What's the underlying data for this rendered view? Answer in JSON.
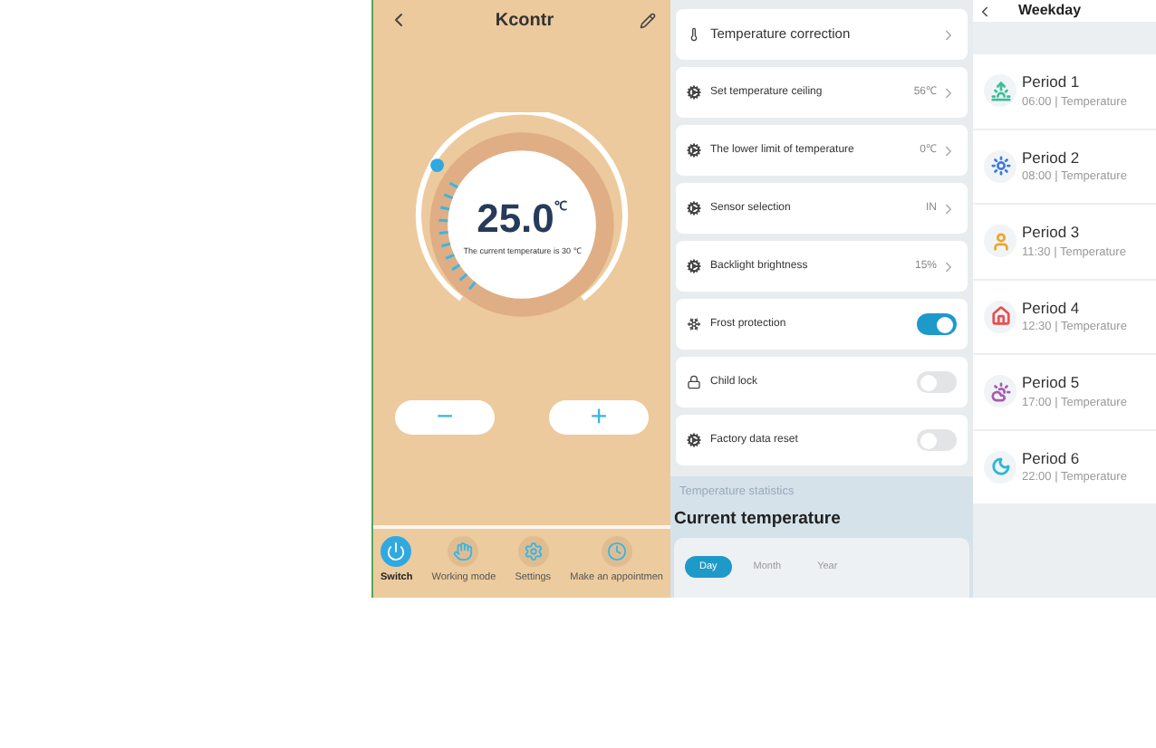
{
  "thermostat": {
    "title": "Kcontr",
    "set_temperature": "25.0",
    "unit": "℃",
    "current_text": "The current temperature is 30 ℃",
    "minus": "−",
    "plus": "+"
  },
  "nav": [
    {
      "label": "Switch",
      "kind": "power",
      "selected": true
    },
    {
      "label": "Working mode",
      "kind": "hand",
      "selected": false
    },
    {
      "label": "Settings",
      "kind": "gear",
      "selected": false
    },
    {
      "label": "Make an appointmen",
      "kind": "clock",
      "selected": false
    }
  ],
  "settings": [
    {
      "label": "Temperature correction",
      "kind": "link"
    },
    {
      "label": "Set temperature ceiling",
      "kind": "link",
      "value": "56℃"
    },
    {
      "label": "The lower limit of temperature",
      "kind": "link",
      "value": "0℃"
    },
    {
      "label": "Sensor selection",
      "kind": "link",
      "value": "IN"
    },
    {
      "label": "Backlight brightness",
      "kind": "link",
      "value": "15%"
    },
    {
      "label": "Frost protection",
      "kind": "toggle",
      "on": true
    },
    {
      "label": "Child lock",
      "kind": "toggle",
      "on": false
    },
    {
      "label": "Factory data reset",
      "kind": "toggle",
      "on": false
    }
  ],
  "statistics": {
    "section": "Temperature statistics",
    "title": "Current temperature",
    "tabs": [
      {
        "label": "Day",
        "selected": true
      },
      {
        "label": "Month",
        "selected": false
      },
      {
        "label": "Year",
        "selected": false
      }
    ]
  },
  "schedule": {
    "title": "Weekday",
    "periods": [
      {
        "name": "Period 1",
        "detail": "06:00 | Temperature",
        "kind": "sunrise",
        "color": "#3cbf9a"
      },
      {
        "name": "Period 2",
        "detail": "08:00 | Temperature",
        "kind": "sun",
        "color": "#3b7de0"
      },
      {
        "name": "Period 3",
        "detail": "11:30 | Temperature",
        "kind": "person",
        "color": "#f0a52a"
      },
      {
        "name": "Period 4",
        "detail": "12:30 | Temperature",
        "kind": "home",
        "color": "#e8504f"
      },
      {
        "name": "Period 5",
        "detail": "17:00 | Temperature",
        "kind": "cloud",
        "color": "#a55cb0"
      },
      {
        "name": "Period 6",
        "detail": "22:00 | Temperature",
        "kind": "moon",
        "color": "#29b6d8"
      }
    ]
  }
}
